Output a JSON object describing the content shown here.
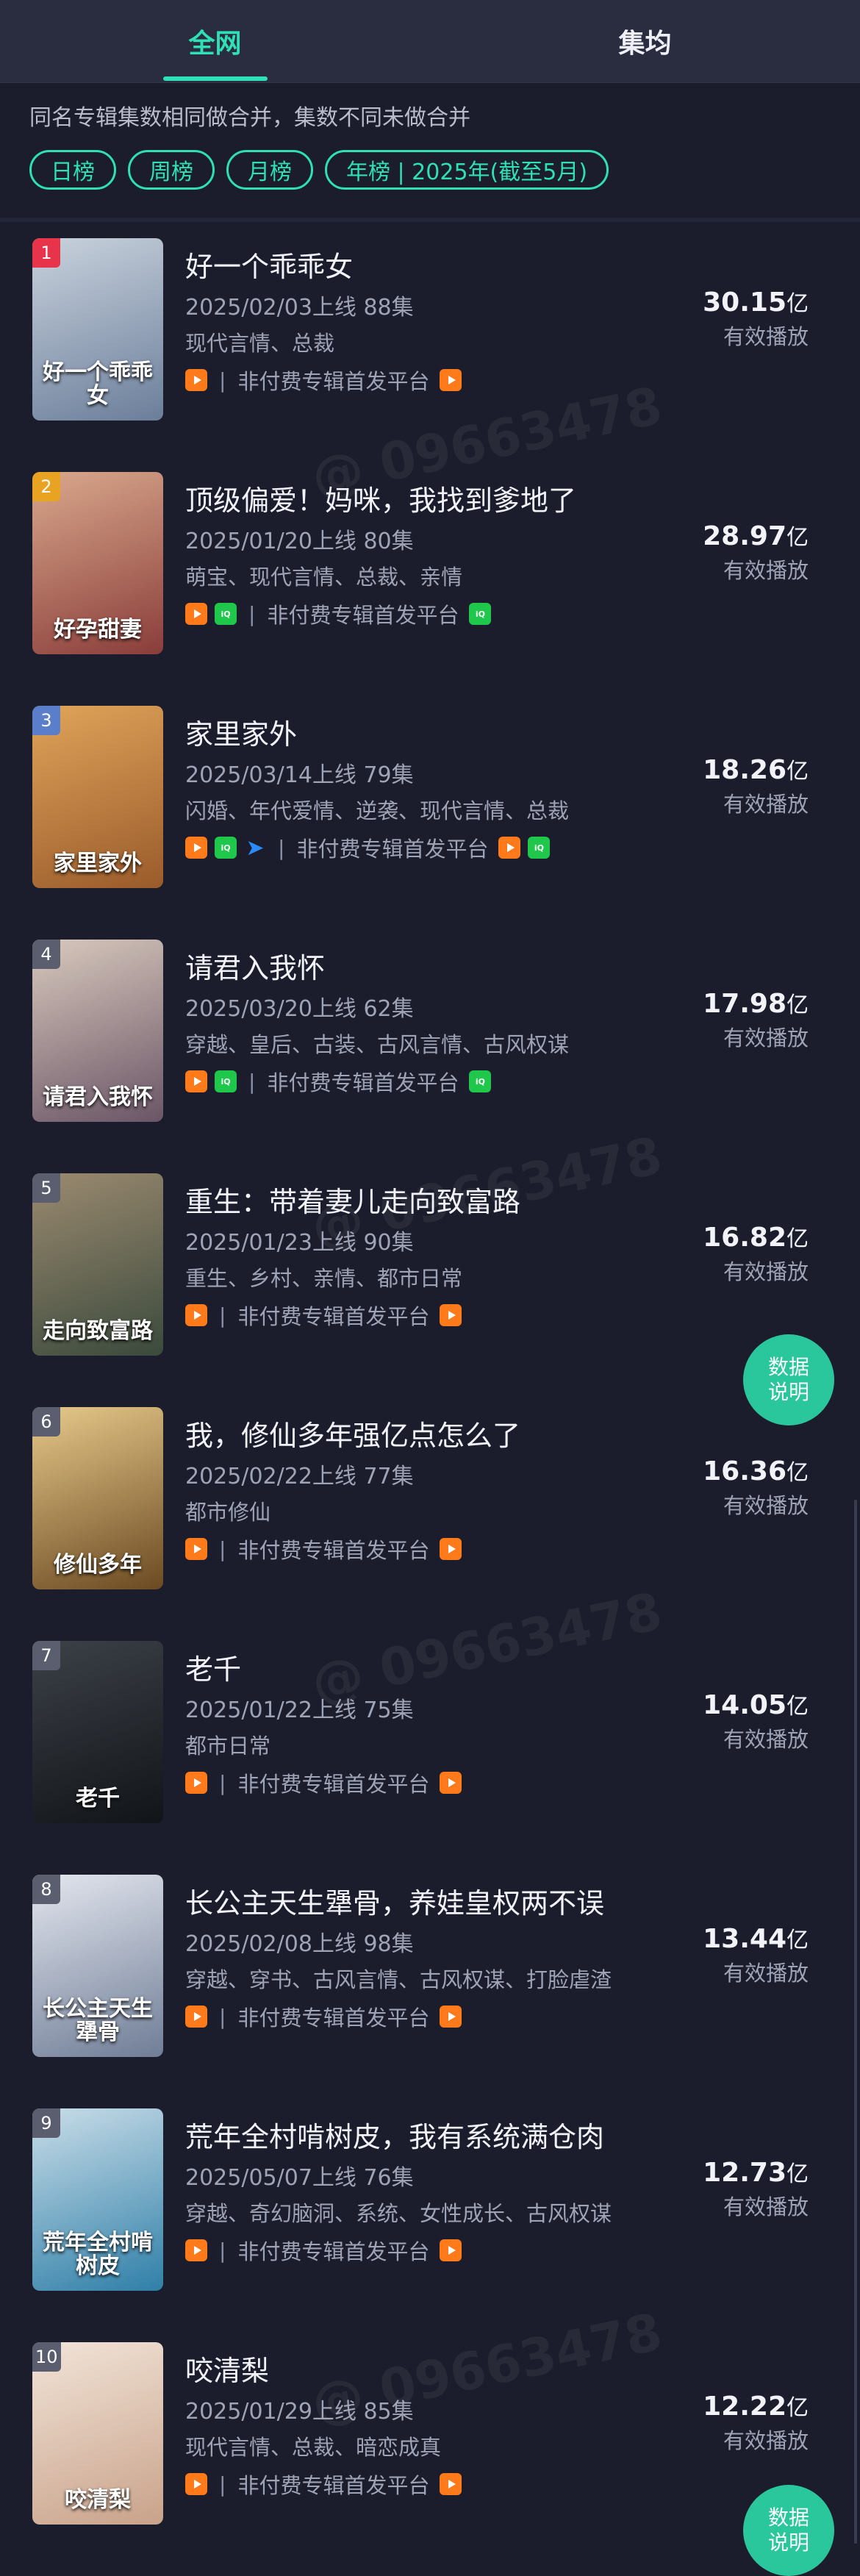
{
  "tabs": [
    {
      "label": "全网",
      "active": true
    },
    {
      "label": "集均",
      "active": false
    }
  ],
  "note": "同名专辑集数相同做合并，集数不同未做合并",
  "chips": [
    "日榜",
    "周榜",
    "月榜",
    "年榜 | 2025年(截至5月)"
  ],
  "platform_text": "非付费专辑首发平台",
  "value_label": "有效播放",
  "value_unit": "亿",
  "fab_label": [
    "数据",
    "说明"
  ],
  "watermark": "@ 09663478",
  "items": [
    {
      "rank": "1",
      "title": "好一个乖乖女",
      "meta": "2025/02/03上线 88集",
      "tags": "现代言情、总裁",
      "value": "30.15",
      "platforms": [
        "tv"
      ],
      "first": [
        "tv"
      ],
      "poster_text": "好一个乖乖女",
      "rank_color": "#e8344a",
      "poster_colors": [
        "#6b7e9a",
        "#c9d2dd"
      ]
    },
    {
      "rank": "2",
      "title": "顶级偏爱！妈咪，我找到爹地了",
      "meta": "2025/01/20上线 80集",
      "tags": "萌宝、现代言情、总裁、亲情",
      "value": "28.97",
      "platforms": [
        "tv",
        "iqy"
      ],
      "first": [
        "iqy"
      ],
      "poster_text": "好孕甜妻",
      "rank_color": "#e8a323",
      "poster_colors": [
        "#8a3d3a",
        "#d9a88c"
      ]
    },
    {
      "rank": "3",
      "title": "家里家外",
      "meta": "2025/03/14上线 79集",
      "tags": "闪婚、年代爱情、逆袭、现代言情、总裁",
      "value": "18.26",
      "platforms": [
        "tv",
        "iqy",
        "arrow"
      ],
      "first": [
        "tv",
        "iqy"
      ],
      "poster_text": "家里家外",
      "rank_color": "#5a7ec9",
      "poster_colors": [
        "#9a5b2b",
        "#e0a45a"
      ]
    },
    {
      "rank": "4",
      "title": "请君入我怀",
      "meta": "2025/03/20上线 62集",
      "tags": "穿越、皇后、古装、古风言情、古风权谋",
      "value": "17.98",
      "platforms": [
        "tv",
        "iqy"
      ],
      "first": [
        "iqy"
      ],
      "poster_text": "请君入我怀",
      "rank_color": "#5b5e6e",
      "poster_colors": [
        "#6a5566",
        "#d8c9bd"
      ]
    },
    {
      "rank": "5",
      "title": "重生：带着妻儿走向致富路",
      "meta": "2025/01/23上线 90集",
      "tags": "重生、乡村、亲情、都市日常",
      "value": "16.82",
      "platforms": [
        "tv"
      ],
      "first": [
        "tv"
      ],
      "poster_text": "走向致富路",
      "rank_color": "#5b5e6e",
      "poster_colors": [
        "#3b4a3c",
        "#9b8a70"
      ]
    },
    {
      "rank": "6",
      "title": "我，修仙多年强亿点怎么了",
      "meta": "2025/02/22上线 77集",
      "tags": "都市修仙",
      "value": "16.36",
      "platforms": [
        "tv"
      ],
      "first": [
        "tv"
      ],
      "poster_text": "修仙多年",
      "rank_color": "#5b5e6e",
      "poster_colors": [
        "#6b4a22",
        "#e6c98a"
      ]
    },
    {
      "rank": "7",
      "title": "老千",
      "meta": "2025/01/22上线 75集",
      "tags": "都市日常",
      "value": "14.05",
      "platforms": [
        "tv"
      ],
      "first": [
        "tv"
      ],
      "poster_text": "老千",
      "rank_color": "#5b5e6e",
      "poster_colors": [
        "#111418",
        "#3c4148"
      ]
    },
    {
      "rank": "8",
      "title": "长公主天生犟骨，养娃皇权两不误",
      "meta": "2025/02/08上线 98集",
      "tags": "穿越、穿书、古风言情、古风权谋、打脸虐渣",
      "value": "13.44",
      "platforms": [
        "tv"
      ],
      "first": [
        "tv"
      ],
      "poster_text": "长公主天生犟骨",
      "rank_color": "#5b5e6e",
      "poster_colors": [
        "#6f7d96",
        "#e3e6ee"
      ]
    },
    {
      "rank": "9",
      "title": "荒年全村啃树皮，我有系统满仓肉",
      "meta": "2025/05/07上线 76集",
      "tags": "穿越、奇幻脑洞、系统、女性成长、古风权谋",
      "value": "12.73",
      "platforms": [
        "tv"
      ],
      "first": [
        "tv"
      ],
      "poster_text": "荒年全村啃树皮",
      "rank_color": "#5b5e6e",
      "poster_colors": [
        "#2f7fa8",
        "#c9dde8"
      ]
    },
    {
      "rank": "10",
      "title": "咬清梨",
      "meta": "2025/01/29上线 85集",
      "tags": "现代言情、总裁、暗恋成真",
      "value": "12.22",
      "platforms": [
        "tv"
      ],
      "first": [
        "tv"
      ],
      "poster_text": "咬清梨",
      "rank_color": "#5b5e6e",
      "poster_colors": [
        "#c9a28a",
        "#f1e4d8"
      ]
    }
  ]
}
